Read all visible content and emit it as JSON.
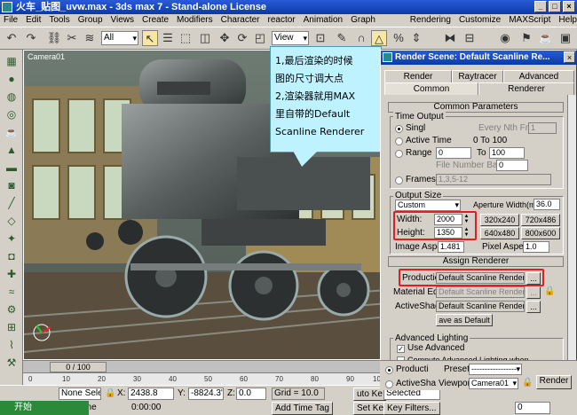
{
  "window": {
    "title": "火车_贴图_uvw.max - 3ds max 7 - Stand-alone License"
  },
  "menu": [
    "File",
    "Edit",
    "Tools",
    "Group",
    "Views",
    "Create",
    "Modifiers",
    "Character",
    "reactor",
    "Animation",
    "Graph Editors",
    "Rendering",
    "Customize",
    "MAXScript",
    "Help"
  ],
  "toolbar": {
    "selection_filter": "All",
    "ref_coord": "View"
  },
  "viewport": {
    "label": "Camera01"
  },
  "trackbar": {
    "frame": "0 / 100"
  },
  "ruler": {
    "ticks": [
      "0",
      "10",
      "20",
      "30",
      "40",
      "50",
      "60",
      "70",
      "80",
      "90",
      "100"
    ]
  },
  "callout": {
    "lines": [
      "1,最后渲染的时候",
      "图的尺寸调大点",
      "2,渲染器就用MAX",
      "里自带的Default",
      "Scanline Renderer"
    ]
  },
  "dialog": {
    "title": "Render Scene: Default Scanline Re...",
    "tabs_row1": [
      "Render Elements",
      "Raytracer",
      "Advanced Lighting"
    ],
    "tabs_row2": [
      "Common",
      "Renderer"
    ],
    "common_params": "Common Parameters",
    "time_output": {
      "label": "Time Output",
      "single": "Singl",
      "every_nth": "Every Nth Frame:",
      "every_nth_val": "1",
      "active_time": "Active Time",
      "active_range": "0 To 100",
      "range": "Range",
      "range_from": "0",
      "range_to_label": "To",
      "range_to": "100",
      "file_number_base": "File Number Base:",
      "file_number_base_val": "0",
      "frames": "Frames",
      "frames_val": "1,3,5-12"
    },
    "output_size": {
      "label": "Output Size",
      "preset": "Custom",
      "aperture_label": "Aperture Width(mm):",
      "aperture_val": "36.0",
      "width_label": "Width:",
      "width_val": "2000",
      "height_label": "Height:",
      "height_val": "1350",
      "presets": [
        "320x240",
        "720x486",
        "640x480",
        "800x600"
      ],
      "image_aspect_label": "Image Aspect:",
      "image_aspect_val": "1.481",
      "pixel_aspect_label": "Pixel Aspect:",
      "pixel_aspect_val": "1.0"
    },
    "assign_renderer": {
      "header": "Assign Renderer",
      "production_label": "Production:",
      "production_val": "Default Scanline Renderer",
      "material_label": "Material Editor:",
      "material_val": "Default Scanline Renderer",
      "activeshade_label": "ActiveShade:",
      "activeshade_val": "Default Scanline Renderer",
      "save_default": "ave as Default",
      "ellipsis": "..."
    },
    "advanced_lighting": {
      "label": "Advanced Lighting",
      "use": "Use Advanced",
      "compute": "Compute Advanced Lighting when"
    },
    "bottom": {
      "production": "Producti",
      "preset_label": "Preset:",
      "preset_val": "------------------",
      "activeshade": "ActiveSha",
      "viewport_label": "Viewport:",
      "viewport_val": "Camera01",
      "render": "Render"
    }
  },
  "status": {
    "none_selected": "None Sele",
    "x_label": "X:",
    "x_val": "2438.8",
    "y_label": "Y:",
    "y_val": "-8824.3'",
    "z_label": "Z:",
    "z_val": "0.0",
    "grid": "Grid = 10.0",
    "auto_key": "uto Ke",
    "selected": "Selected",
    "rendering_time": "ering Time",
    "time_val": "0:00:00",
    "add_time_tag": "Add Time Tag",
    "set_key": "Set Key",
    "key_filters": "Key Filters...",
    "frame": "0"
  },
  "taskbar": {
    "start": "开始"
  }
}
